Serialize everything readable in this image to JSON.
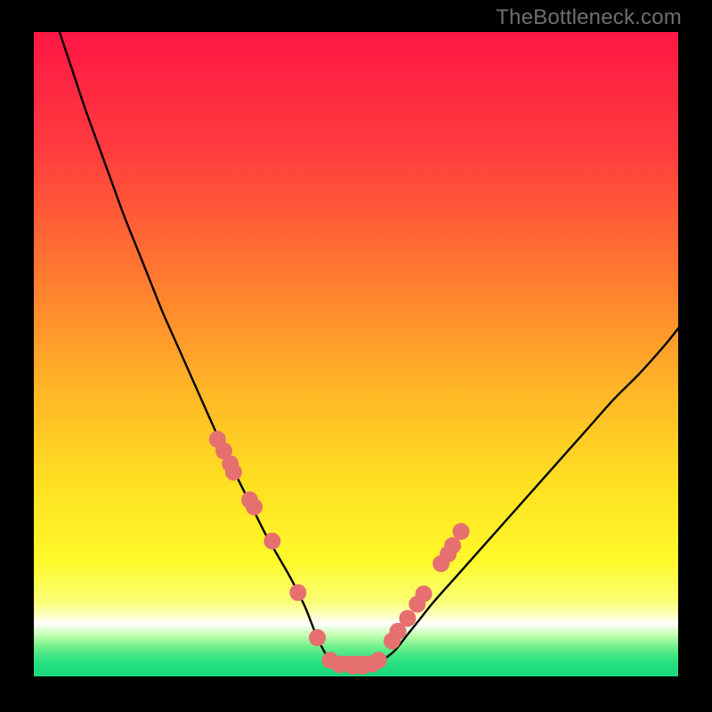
{
  "watermark": "TheBottleneck.com",
  "colors": {
    "black": "#000000",
    "curve": "#000000",
    "marker_fill": "#e6706f",
    "marker_stroke": "#c65a59",
    "gradient_stops": [
      {
        "offset": 0.0,
        "color": "#ff1744"
      },
      {
        "offset": 0.18,
        "color": "#ff3b3f"
      },
      {
        "offset": 0.38,
        "color": "#ff7a2f"
      },
      {
        "offset": 0.55,
        "color": "#ffb427"
      },
      {
        "offset": 0.7,
        "color": "#ffe022"
      },
      {
        "offset": 0.82,
        "color": "#fff92a"
      },
      {
        "offset": 0.885,
        "color": "#f9ff76"
      },
      {
        "offset": 0.905,
        "color": "#fdffc2"
      },
      {
        "offset": 0.918,
        "color": "#ffffff"
      },
      {
        "offset": 0.935,
        "color": "#c7ffb3"
      },
      {
        "offset": 0.955,
        "color": "#6cf089"
      },
      {
        "offset": 0.975,
        "color": "#2de282"
      },
      {
        "offset": 1.0,
        "color": "#17d67a"
      }
    ]
  },
  "chart_data": {
    "type": "line",
    "title": "",
    "xlabel": "",
    "ylabel": "",
    "xlim": [
      0,
      100
    ],
    "ylim": [
      0,
      100
    ],
    "series": [
      {
        "name": "bottleneck-curve",
        "x": [
          4,
          6,
          8,
          10,
          12,
          14,
          16,
          18,
          20,
          22,
          24,
          26,
          28,
          30,
          32,
          34,
          36,
          38,
          40,
          42,
          43,
          44,
          45,
          46,
          47,
          48,
          50,
          52,
          54,
          56,
          58,
          60,
          62,
          66,
          70,
          74,
          78,
          82,
          86,
          90,
          94,
          98,
          100
        ],
        "y": [
          100,
          94,
          88,
          82.5,
          77,
          71.5,
          66.5,
          61.5,
          56.5,
          52,
          47.5,
          43,
          38.5,
          34,
          30,
          26,
          22,
          18.5,
          15,
          11,
          8.5,
          6,
          4,
          2.5,
          1.8,
          1.5,
          1.5,
          1.8,
          2.5,
          4,
          6.5,
          9,
          11.5,
          16,
          20.5,
          25,
          29.5,
          34,
          38.5,
          43,
          47,
          51.5,
          54
        ]
      }
    ],
    "markers": {
      "name": "pink-dots",
      "x": [
        28.5,
        29.5,
        30.5,
        31.0,
        33.5,
        34.2,
        37.0,
        41.0,
        44.0,
        46.0,
        47.5,
        49.5,
        51.0,
        52.5,
        53.5,
        55.6,
        56.5,
        58.0,
        59.5,
        60.5,
        63.2,
        64.3,
        65.0,
        66.3
      ],
      "y": [
        36.8,
        35.0,
        33.0,
        31.7,
        27.4,
        26.3,
        21.0,
        13.0,
        6.0,
        2.5,
        1.8,
        1.6,
        1.6,
        1.9,
        2.5,
        5.5,
        7.0,
        9.0,
        11.2,
        12.8,
        17.5,
        19.0,
        20.3,
        22.5
      ]
    }
  }
}
